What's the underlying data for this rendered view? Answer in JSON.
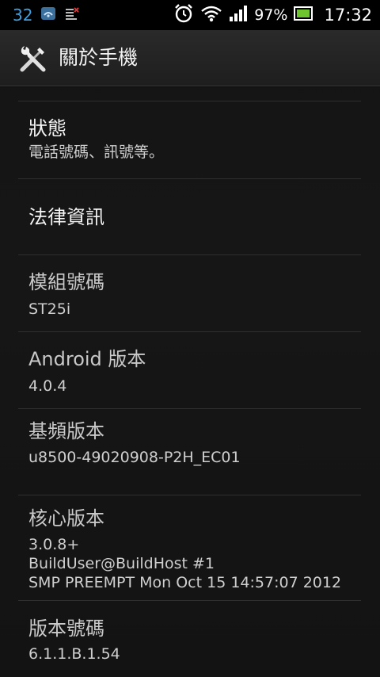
{
  "status_bar": {
    "left_number": "32",
    "battery_percent": "97%",
    "time": "17:32",
    "icons": [
      "gallery-icon",
      "sim-notification-icon",
      "alarm-clock-icon",
      "wifi-icon",
      "signal-icon",
      "battery-icon"
    ],
    "accent_color": "#3fa0e0",
    "battery_color": "#6ec42f"
  },
  "action_bar": {
    "title": "關於手機",
    "icon": "tools-icon"
  },
  "items": [
    {
      "title": "狀態",
      "summary": "電話號碼、訊號等。",
      "clickable": true
    },
    {
      "title": "法律資訊",
      "summary": "",
      "clickable": true
    },
    {
      "title": "模組號碼",
      "summary": "ST25i",
      "clickable": false
    },
    {
      "title": "Android 版本",
      "summary": "4.0.4",
      "clickable": true
    },
    {
      "title": "基頻版本",
      "summary": "u8500-49020908-P2H_EC01",
      "clickable": false
    },
    {
      "title": "核心版本",
      "summary_lines": [
        "3.0.8+",
        "BuildUser@BuildHost #1",
        "SMP PREEMPT Mon Oct 15 14:57:07 2012"
      ],
      "clickable": false
    },
    {
      "title": "版本號碼",
      "summary": "6.1.1.B.1.54",
      "clickable": true
    }
  ]
}
